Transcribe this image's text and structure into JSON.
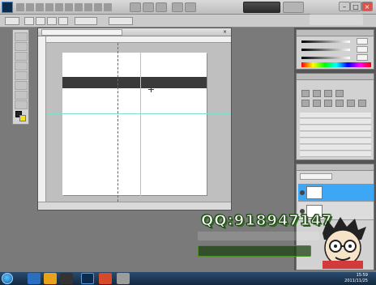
{
  "menubar": {
    "items": [
      {
        "label": ""
      },
      {
        "label": ""
      },
      {
        "label": ""
      },
      {
        "label": ""
      },
      {
        "label": ""
      },
      {
        "label": ""
      },
      {
        "label": ""
      },
      {
        "label": ""
      },
      {
        "label": ""
      },
      {
        "label": ""
      }
    ],
    "workspace_label": "",
    "live_label": ""
  },
  "document": {
    "tab_title": "",
    "status_text": ""
  },
  "panels": {
    "color_tabs": "",
    "adjust_tabs": "",
    "adjust_title": "",
    "preset_items": [
      {
        "label": ""
      },
      {
        "label": ""
      },
      {
        "label": ""
      },
      {
        "label": ""
      },
      {
        "label": ""
      },
      {
        "label": ""
      },
      {
        "label": ""
      }
    ],
    "layers_tabs": "",
    "blend_mode": "",
    "opacity_label": "",
    "layers": [
      {
        "name": "",
        "selected": true
      },
      {
        "name": "",
        "selected": false
      }
    ],
    "slider_values": [
      "",
      "",
      ""
    ]
  },
  "watermark": {
    "qq": "QQ:918947147",
    "line1": "",
    "line2": ""
  },
  "taskbar": {
    "time": "15:59",
    "date": "2011/11/25"
  },
  "colors": {
    "accent_blue": "#3da7f5",
    "selection_bar": "#3a3a3a",
    "guide_cyan": "#7fe0d0",
    "watermark_green": "#2b6d1a"
  }
}
